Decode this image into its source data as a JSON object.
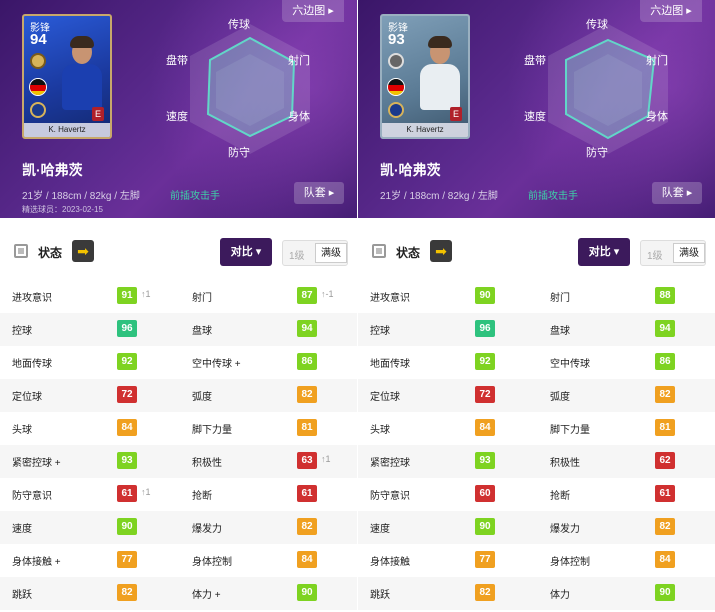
{
  "colors": {
    "green_bright": "#7ed321",
    "green_teal": "#2ec27e",
    "orange": "#f0a020",
    "red": "#d03030",
    "purple_button": "#3c1a5c",
    "role_teal": "#3ed0a8"
  },
  "panels": [
    {
      "card": {
        "position": "影锋",
        "rating": "94",
        "player_name": "K. Havertz",
        "style": "blue"
      },
      "hexagon_button": "六边图 ▸",
      "radar_labels": {
        "top": "传球",
        "upper_left": "盘带",
        "upper_right": "射门",
        "lower_left": "速度",
        "lower_right": "身体",
        "bottom": "防守"
      },
      "player_name": "凯·哈弗茨",
      "info": "21岁 / 188cm / 82kg / 左脚",
      "role": "前插攻击手",
      "selected_date": "精选球员：2023-02-15",
      "squad_button": "队套 ▸",
      "toolbar": {
        "status_label": "状态",
        "arrow": "➡",
        "compare_button": "对比 ▾",
        "level_1": "1级",
        "level_max": "满级"
      },
      "stats": [
        {
          "left": {
            "name": "进攻意识",
            "value": "91",
            "color": "#7ed321",
            "delta": "↑1"
          },
          "right": {
            "name": "射门",
            "value": "87",
            "color": "#7ed321",
            "delta": "↑-1"
          }
        },
        {
          "left": {
            "name": "控球",
            "value": "96",
            "color": "#2ec27e",
            "delta": ""
          },
          "right": {
            "name": "盘球",
            "value": "94",
            "color": "#7ed321",
            "delta": ""
          }
        },
        {
          "left": {
            "name": "地面传球",
            "value": "92",
            "color": "#7ed321",
            "delta": ""
          },
          "right": {
            "name": "空中传球 +",
            "value": "86",
            "color": "#7ed321",
            "delta": ""
          }
        },
        {
          "left": {
            "name": "定位球",
            "value": "72",
            "color": "#d03030",
            "delta": ""
          },
          "right": {
            "name": "弧度",
            "value": "82",
            "color": "#f0a020",
            "delta": ""
          }
        },
        {
          "left": {
            "name": "头球",
            "value": "84",
            "color": "#f0a020",
            "delta": ""
          },
          "right": {
            "name": "脚下力量",
            "value": "81",
            "color": "#f0a020",
            "delta": ""
          }
        },
        {
          "left": {
            "name": "紧密控球 +",
            "value": "93",
            "color": "#7ed321",
            "delta": ""
          },
          "right": {
            "name": "积极性",
            "value": "63",
            "color": "#d03030",
            "delta": "↑1"
          }
        },
        {
          "left": {
            "name": "防守意识",
            "value": "61",
            "color": "#d03030",
            "delta": "↑1"
          },
          "right": {
            "name": "抢断",
            "value": "61",
            "color": "#d03030",
            "delta": ""
          }
        },
        {
          "left": {
            "name": "速度",
            "value": "90",
            "color": "#7ed321",
            "delta": ""
          },
          "right": {
            "name": "爆发力",
            "value": "82",
            "color": "#f0a020",
            "delta": ""
          }
        },
        {
          "left": {
            "name": "身体接触 +",
            "value": "77",
            "color": "#f0a020",
            "delta": ""
          },
          "right": {
            "name": "身体控制",
            "value": "84",
            "color": "#f0a020",
            "delta": ""
          }
        },
        {
          "left": {
            "name": "跳跃",
            "value": "82",
            "color": "#f0a020",
            "delta": ""
          },
          "right": {
            "name": "体力 +",
            "value": "90",
            "color": "#7ed321",
            "delta": ""
          }
        }
      ]
    },
    {
      "card": {
        "position": "影锋",
        "rating": "93",
        "player_name": "K. Havertz",
        "style": "grey"
      },
      "hexagon_button": "六边图 ▸",
      "radar_labels": {
        "top": "传球",
        "upper_left": "盘带",
        "upper_right": "射门",
        "lower_left": "速度",
        "lower_right": "身体",
        "bottom": "防守"
      },
      "player_name": "凯·哈弗茨",
      "info": "21岁 / 188cm / 82kg / 左脚",
      "role": "前插攻击手",
      "selected_date": "",
      "squad_button": "队套 ▸",
      "toolbar": {
        "status_label": "状态",
        "arrow": "➡",
        "compare_button": "对比 ▾",
        "level_1": "1级",
        "level_max": "满级"
      },
      "stats": [
        {
          "left": {
            "name": "进攻意识",
            "value": "90",
            "color": "#7ed321",
            "delta": ""
          },
          "right": {
            "name": "射门",
            "value": "88",
            "color": "#7ed321",
            "delta": ""
          }
        },
        {
          "left": {
            "name": "控球",
            "value": "96",
            "color": "#2ec27e",
            "delta": ""
          },
          "right": {
            "name": "盘球",
            "value": "94",
            "color": "#7ed321",
            "delta": ""
          }
        },
        {
          "left": {
            "name": "地面传球",
            "value": "92",
            "color": "#7ed321",
            "delta": ""
          },
          "right": {
            "name": "空中传球",
            "value": "86",
            "color": "#7ed321",
            "delta": ""
          }
        },
        {
          "left": {
            "name": "定位球",
            "value": "72",
            "color": "#d03030",
            "delta": ""
          },
          "right": {
            "name": "弧度",
            "value": "82",
            "color": "#f0a020",
            "delta": ""
          }
        },
        {
          "left": {
            "name": "头球",
            "value": "84",
            "color": "#f0a020",
            "delta": ""
          },
          "right": {
            "name": "脚下力量",
            "value": "81",
            "color": "#f0a020",
            "delta": ""
          }
        },
        {
          "left": {
            "name": "紧密控球",
            "value": "93",
            "color": "#7ed321",
            "delta": ""
          },
          "right": {
            "name": "积极性",
            "value": "62",
            "color": "#d03030",
            "delta": ""
          }
        },
        {
          "left": {
            "name": "防守意识",
            "value": "60",
            "color": "#d03030",
            "delta": ""
          },
          "right": {
            "name": "抢断",
            "value": "61",
            "color": "#d03030",
            "delta": ""
          }
        },
        {
          "left": {
            "name": "速度",
            "value": "90",
            "color": "#7ed321",
            "delta": ""
          },
          "right": {
            "name": "爆发力",
            "value": "82",
            "color": "#f0a020",
            "delta": ""
          }
        },
        {
          "left": {
            "name": "身体接触",
            "value": "77",
            "color": "#f0a020",
            "delta": ""
          },
          "right": {
            "name": "身体控制",
            "value": "84",
            "color": "#f0a020",
            "delta": ""
          }
        },
        {
          "left": {
            "name": "跳跃",
            "value": "82",
            "color": "#f0a020",
            "delta": ""
          },
          "right": {
            "name": "体力",
            "value": "90",
            "color": "#7ed321",
            "delta": ""
          }
        }
      ]
    }
  ]
}
